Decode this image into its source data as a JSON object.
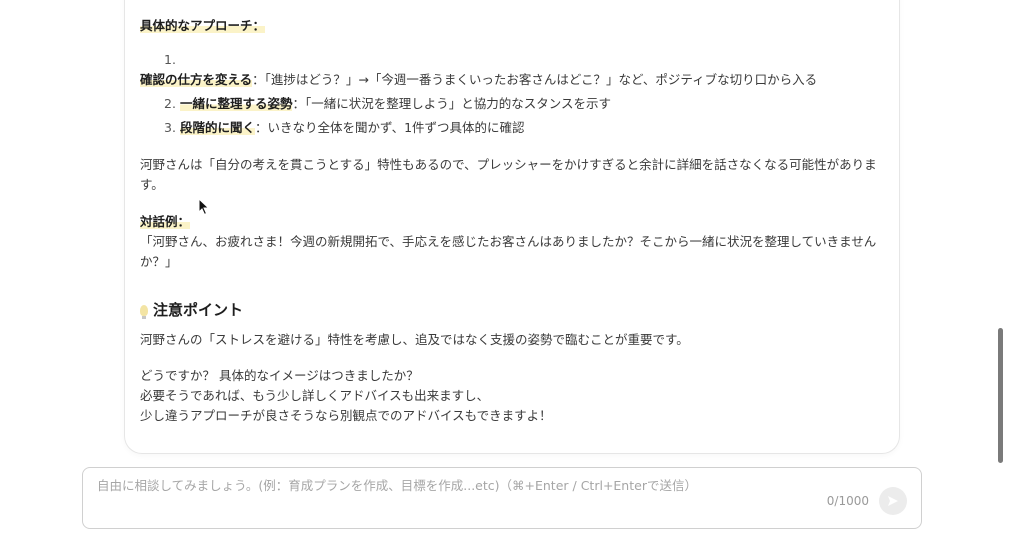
{
  "message": {
    "approach_heading": "具体的なアプローチ：",
    "list": [
      {
        "num": "1.",
        "title": "確認の仕方を変える",
        "text": "：「進捗はどう？」→「今週一番うまくいったお客さんはどこ？」など、ポジティブな切り口から入る"
      },
      {
        "num": "2.",
        "title": "一緒に整理する姿勢",
        "text": "：「一緒に状況を整理しよう」と協力的なスタンスを示す"
      },
      {
        "num": "3.",
        "title": "段階的に聞く",
        "text": "：いきなり全体を聞かず、1件ずつ具体的に確認"
      }
    ],
    "para_kono": "河野さんは「自分の考えを貫こうとする」特性もあるので、プレッシャーをかけすぎると余計に詳細を話さなくなる可能性があります。",
    "dialog_heading": "対話例：",
    "dialog_text": "「河野さん、お疲れさま！今週の新規開拓で、手応えを感じたお客さんはありましたか？そこから一緒に状況を整理していきませんか？」",
    "caution_heading": "注意ポイント",
    "caution_text": "河野さんの「ストレスを避ける」特性を考慮し、追及ではなく支援の姿勢で臨むことが重要です。",
    "closing": [
      "どうですか？ 具体的なイメージはつきましたか？",
      "必要そうであれば、もう少し詳しくアドバイスも出来ますし、",
      "少し違うアプローチが良さそうなら別観点でのアドバイスもできますよ！"
    ]
  },
  "composer": {
    "placeholder": "自由に相談してみましょう。(例：育成プランを作成、目標を作成...etc)（⌘+Enter / Ctrl+Enterで送信）",
    "counter": "0/1000"
  },
  "icons": {
    "bulb": "lightbulb-icon",
    "send": "send-icon",
    "cursor": "mouse-cursor-icon"
  }
}
